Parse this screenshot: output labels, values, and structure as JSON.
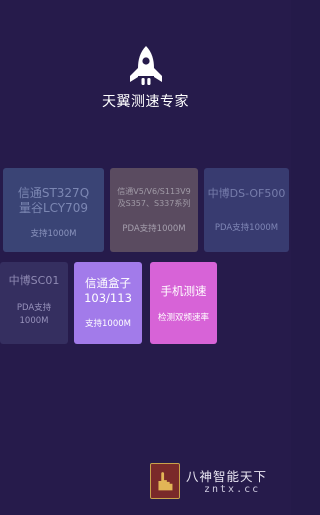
{
  "header": {
    "icon": "rocket-icon",
    "title": "天翼测速专家"
  },
  "tiles": [
    {
      "id": "st327q",
      "name_lines": [
        "信通ST327Q",
        "量谷LCY709"
      ],
      "sub": "支持1000M",
      "bg": "#3a4475",
      "enabled": false
    },
    {
      "id": "v5",
      "name_lines": [
        "信通V5/V6/S113V9",
        "及S357、S337系列"
      ],
      "sub": "PDA支持1000M",
      "bg": "#5a4b60",
      "enabled": false
    },
    {
      "id": "ds",
      "name_lines": [
        "中博DS-OF500"
      ],
      "sub": "PDA支持1000M",
      "bg": "#383b70",
      "enabled": false
    },
    {
      "id": "sc01",
      "name_lines": [
        "中博SC01"
      ],
      "sub": "PDA支持1000M",
      "bg": "#352f60",
      "enabled": false
    },
    {
      "id": "box",
      "name_lines": [
        "信通盒子",
        "103/113"
      ],
      "sub": "支持1000M",
      "bg": "#a27bea",
      "enabled": true
    },
    {
      "id": "phone",
      "name_lines": [
        "手机测速"
      ],
      "sub": "检测双频速率",
      "bg": "#d763d7",
      "enabled": true
    }
  ],
  "watermark": {
    "icon": "pointing-hand-badge-icon",
    "title": "八神智能天下",
    "url": "zntx.cc"
  },
  "colors": {
    "background": "#261b4b",
    "accent_purple": "#a27bea",
    "accent_pink": "#d763d7"
  }
}
